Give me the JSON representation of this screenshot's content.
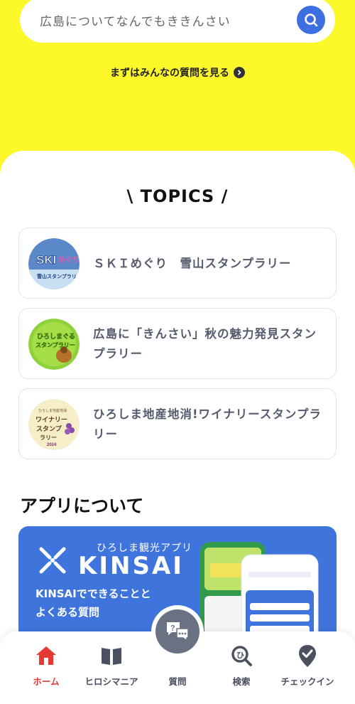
{
  "search": {
    "placeholder": "広島についてなんでもききんさい",
    "button_icon": "search-icon"
  },
  "see_questions_label": "まずはみんなの質問を見る",
  "topics": {
    "title": "\\ TOPICS /",
    "items": [
      {
        "label": "ＳＫＩめぐり　雪山スタンプラリー",
        "thumb_text": "SKIめぐり",
        "thumb_caption": "雪山スタンプラリー"
      },
      {
        "label": "広島に「きんさい」秋の魅力発見スタンプラリー",
        "thumb_text": "ひろしまぐるスタンプラリー"
      },
      {
        "label": "ひろしま地産地消!ワイナリースタンプラリー",
        "thumb_text": "ワイナリースタンプラリー",
        "thumb_caption": "2024"
      }
    ]
  },
  "about": {
    "title": "アプリについて",
    "banner": {
      "subtitle": "ひろしま観光アプリ",
      "name": "KINSAI",
      "line1": "KINSAIでできることと",
      "line2": "よくある質問"
    }
  },
  "tabbar": {
    "items": [
      {
        "label": "ホーム",
        "icon": "home-icon",
        "active": true
      },
      {
        "label": "ヒロシマニア",
        "icon": "book-icon",
        "active": false
      },
      {
        "label": "質問",
        "icon": "question-chat-icon",
        "active": false
      },
      {
        "label": "検索",
        "icon": "search-icon",
        "active": false
      },
      {
        "label": "チェックイン",
        "icon": "checkin-icon",
        "active": false
      }
    ]
  },
  "colors": {
    "accent_yellow": "#fdf82a",
    "brand_blue": "#3f74dc",
    "active_red": "#e53a33"
  }
}
